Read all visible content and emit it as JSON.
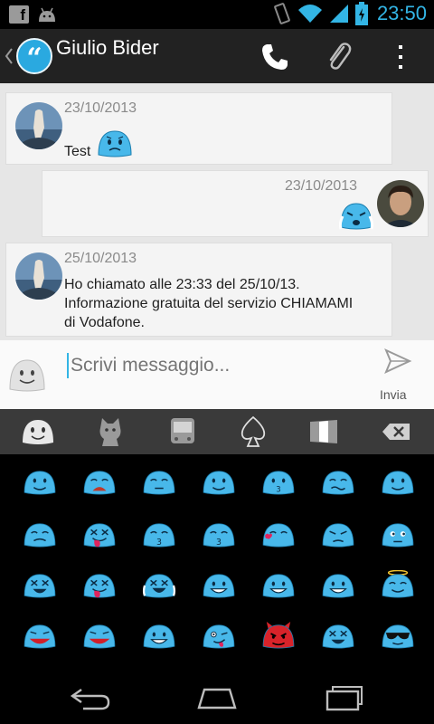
{
  "status_bar": {
    "time": "23:50",
    "left_icons": [
      "facebook-icon",
      "android-icon"
    ],
    "right_icons": [
      "vibrate-icon",
      "wifi-icon",
      "signal-icon",
      "battery-icon"
    ]
  },
  "action_bar": {
    "title": "Giulio Bider",
    "accent": "#33b5e5"
  },
  "messages": [
    {
      "date": "23/10/2013",
      "text": "Test",
      "direction": "incoming"
    },
    {
      "date": "23/10/2013",
      "text": "",
      "direction": "outgoing"
    },
    {
      "date": "25/10/2013",
      "lines": [
        "Ho chiamato alle 23:33 del 25/10/13.",
        "Informazione gratuita del servizio CHIAMAMI",
        "di Vodafone."
      ],
      "direction": "incoming"
    }
  ],
  "composer": {
    "placeholder": "Scrivi messaggio...",
    "send_label": "Invia"
  },
  "emoji_tabs": [
    "smiley-tab-icon",
    "cat-tab-icon",
    "bus-tab-icon",
    "spade-tab-icon",
    "flag-tab-icon",
    "backspace-icon"
  ],
  "emoji_grid": {
    "rows": 4,
    "columns": 7,
    "body_color": "#48b8ea",
    "devil_color": "#d9232a"
  },
  "nav_bar": [
    "back-icon",
    "home-icon",
    "recents-icon"
  ]
}
